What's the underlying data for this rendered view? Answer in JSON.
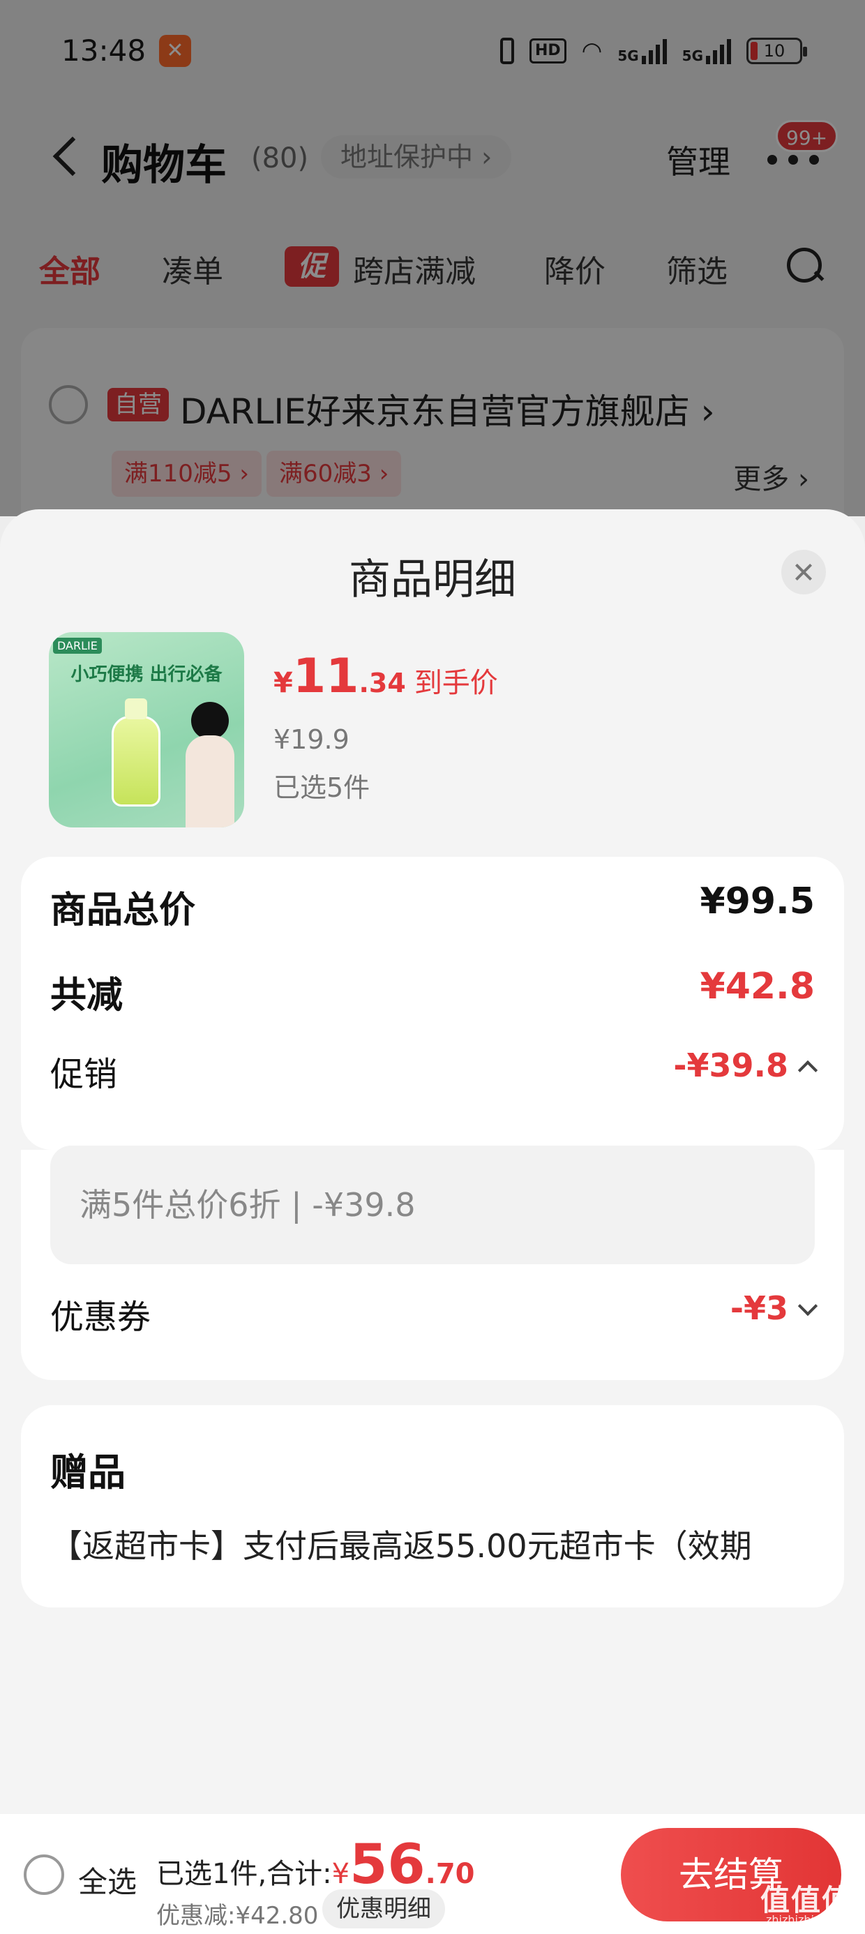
{
  "status_bar": {
    "time": "13:48",
    "hd": "HD",
    "network_1": "5G",
    "network_2": "5G",
    "battery": "10"
  },
  "nav": {
    "title": "购物车",
    "count": "(80)",
    "address_protect": "地址保护中 ›",
    "manage": "管理",
    "badge": "99+"
  },
  "tabs": [
    {
      "label": "全部"
    },
    {
      "label": "凑单"
    },
    {
      "label": "跨店满减",
      "chip": "促"
    },
    {
      "label": "降价"
    },
    {
      "label": "筛选"
    }
  ],
  "store": {
    "self_tag": "自营",
    "name": "DARLIE好来京东自营官方旗舰店 ›",
    "coupons": [
      "满110减5 ›",
      "满60减3 ›"
    ],
    "more": "更多 ›"
  },
  "sheet": {
    "title": "商品明细",
    "product": {
      "logo": "DARLIE",
      "slogan": "小巧便携 出行必备",
      "price_symbol": "¥",
      "price_int": "11",
      "price_dec": ".34",
      "price_tag": "到手价",
      "original_price": "¥19.9",
      "selected": "已选5件"
    },
    "summary": {
      "total_label": "商品总价",
      "total_value": "¥99.5",
      "reduce_label": "共减",
      "reduce_value": "¥42.8",
      "promo_label": "促销",
      "promo_value": "-¥39.8",
      "promo_detail": "满5件总价6折 | -¥39.8",
      "coupon_label": "优惠券",
      "coupon_value": "-¥3"
    },
    "gift": {
      "title": "赠品",
      "desc": "【返超市卡】支付后最高返55.00元超市卡（效期"
    }
  },
  "bottom_bar": {
    "select_all": "全选",
    "selected_prefix": "已选1件,合计:",
    "total_symbol": "¥",
    "total_int": "56",
    "total_dec": ".70",
    "discount": "优惠减:¥42.80",
    "detail_button": "优惠明细",
    "checkout": "去结算"
  },
  "watermark": {
    "main": "值值值",
    "sub": "zhizhizhi.com"
  },
  "colors": {
    "accent": "#e4393c",
    "sheet_bg": "#f4f4f4",
    "overlay": "rgba(0,0,0,0.45)"
  }
}
